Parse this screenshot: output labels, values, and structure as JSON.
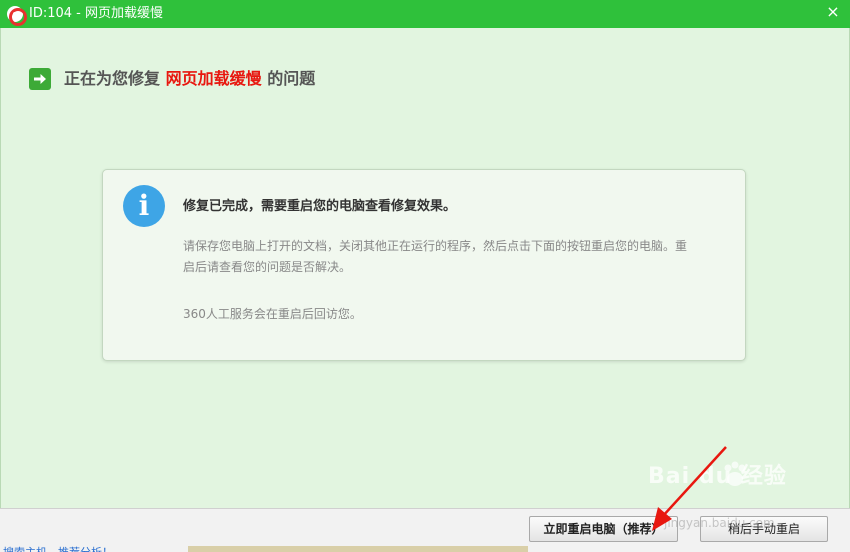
{
  "window": {
    "title": "ID:104 - 网页加载缓慢",
    "close_glyph": "×"
  },
  "heading": {
    "prefix": "正在为您修复",
    "issue": "网页加载缓慢",
    "suffix": "的问题"
  },
  "info": {
    "title": "修复已完成，需要重启您的电脑查看修复效果。",
    "description": "请保存您电脑上打开的文档，关闭其他正在运行的程序，然后点击下面的按钮重启您的电脑。重启后请查看您的问题是否解决。",
    "note": "360人工服务会在重启后回访您。"
  },
  "buttons": {
    "restart_now": "立即重启电脑（推荐）",
    "restart_later": "稍后手动重启"
  },
  "watermark": {
    "text": "Bai du 经验",
    "url": "jingyan.baidu.com"
  },
  "background": {
    "link_text": "搜索主机，推荐分析！"
  },
  "colors": {
    "titlebar": "#2fc13b",
    "highlight": "#e8170f",
    "info_icon": "#3ea5e6",
    "arrow_icon": "#3daa37"
  },
  "icons": {
    "app": "lifebuoy-icon",
    "heading": "arrow-right-icon",
    "info": "info-icon",
    "close": "close-icon"
  }
}
